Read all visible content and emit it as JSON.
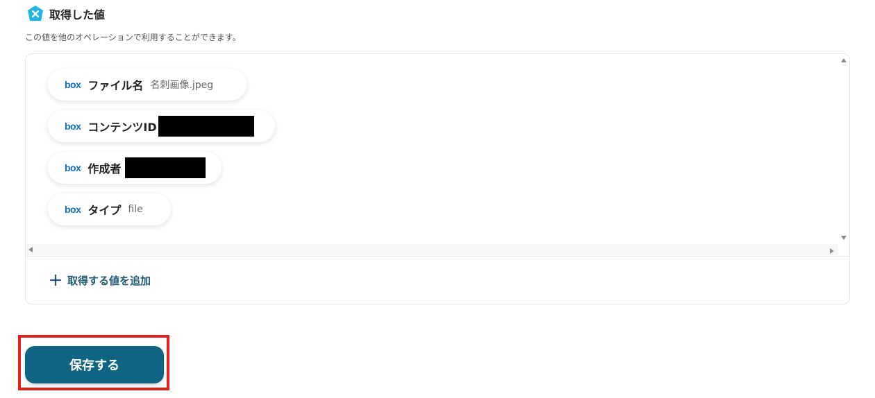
{
  "section": {
    "title": "取得した値",
    "description": "この値を他のオペレーションで利用することができます。"
  },
  "outputs": [
    {
      "service": "box",
      "label": "ファイル名",
      "value": "名刺画像.jpeg",
      "redacted": false
    },
    {
      "service": "box",
      "label": "コンテンツID",
      "value": "",
      "redacted": true
    },
    {
      "service": "box",
      "label": "作成者",
      "value": "",
      "redacted": true
    },
    {
      "service": "box",
      "label": "タイプ",
      "value": "file",
      "redacted": false
    }
  ],
  "add_value_label": "取得する値を追加",
  "save_button_label": "保存する",
  "colors": {
    "accent": "#0e6481",
    "box_brand": "#0a6fc2",
    "icon_bg": "#1fb4e8",
    "highlight": "#e0221b",
    "add_text": "#1f5a74"
  },
  "icons": {
    "section_icon": "yoom-x-icon",
    "plus_icon": "plus-icon"
  }
}
